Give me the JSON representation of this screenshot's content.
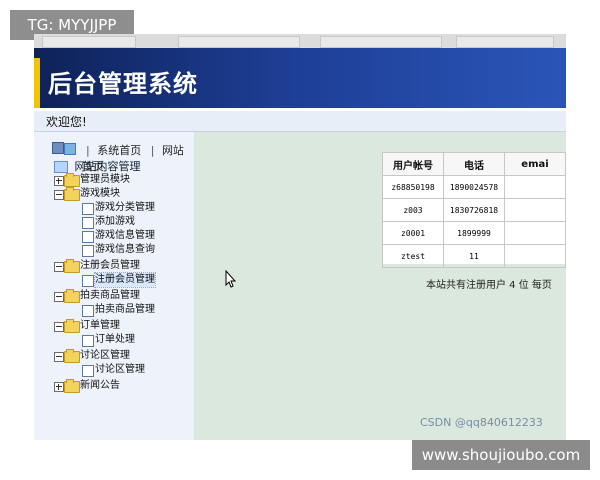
{
  "overlay_label": "TG: MYYJJPP",
  "header": {
    "title": "后台管理系统"
  },
  "welcome": "欢迎您!",
  "sidebar": {
    "links": [
      "系统首页",
      "网站首页"
    ],
    "root": "网站内容管理",
    "tree": [
      {
        "label": "管理员模块",
        "level": 0,
        "expanded": false
      },
      {
        "label": "游戏模块",
        "level": 0,
        "expanded": true
      },
      {
        "label": "游戏分类管理",
        "level": 1
      },
      {
        "label": "添加游戏",
        "level": 1
      },
      {
        "label": "游戏信息管理",
        "level": 1
      },
      {
        "label": "游戏信息查询",
        "level": 1
      },
      {
        "label": "注册会员管理",
        "level": 0,
        "expanded": true
      },
      {
        "label": "注册会员管理",
        "level": 1,
        "selected": true
      },
      {
        "label": "拍卖商品管理",
        "level": 0,
        "expanded": true
      },
      {
        "label": "拍卖商品管理",
        "level": 1
      },
      {
        "label": "订单管理",
        "level": 0,
        "expanded": true
      },
      {
        "label": "订单处理",
        "level": 1
      },
      {
        "label": "讨论区管理",
        "level": 0,
        "expanded": true
      },
      {
        "label": "讨论区管理",
        "level": 1
      },
      {
        "label": "新闻公告",
        "level": 0,
        "expanded": false
      }
    ]
  },
  "table": {
    "headers": [
      "用户帐号",
      "电话",
      "emai"
    ],
    "rows": [
      [
        "z68850198",
        "1890024578",
        ""
      ],
      [
        "z003",
        "1830726818",
        ""
      ],
      [
        "z0001",
        "1899999",
        ""
      ],
      [
        "ztest",
        "11",
        ""
      ]
    ]
  },
  "footer": "本站共有注册用户 4 位  每页",
  "watermark": {
    "csdn": "CSDN @qq840612233",
    "site": "www.shoujioubo.com"
  }
}
